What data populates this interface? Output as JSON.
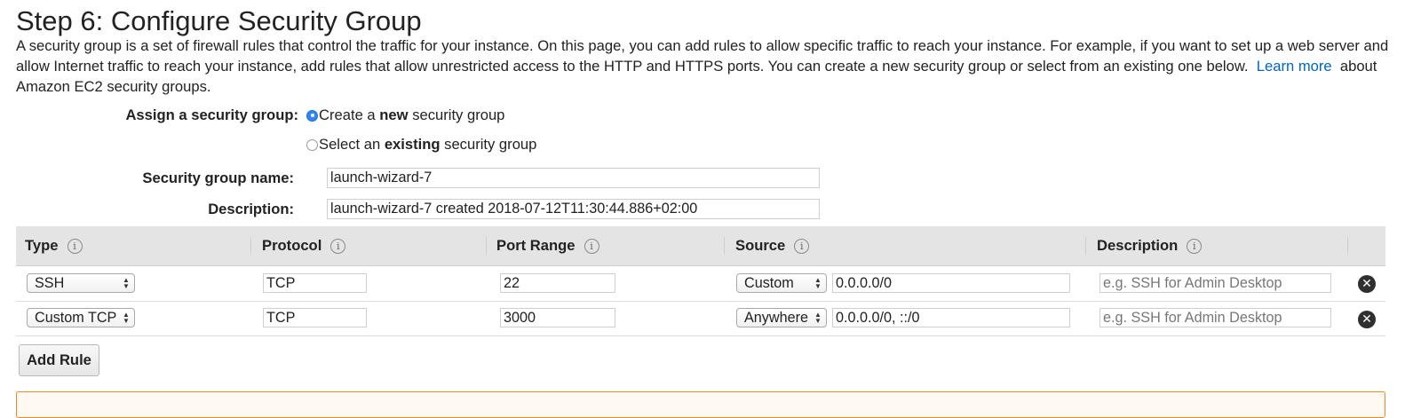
{
  "page": {
    "title": "Step 6: Configure Security Group",
    "intro_text": "A security group is a set of firewall rules that control the traffic for your instance. On this page, you can add rules to allow specific traffic to reach your instance. For example, if you want to set up a web server and allow Internet traffic to reach your instance, add rules that allow unrestricted access to the HTTP and HTTPS ports. You can create a new security group or select from an existing one below.",
    "learn_more_link": "Learn more",
    "intro_tail": "about Amazon EC2 security groups."
  },
  "assign": {
    "label": "Assign a security group:",
    "options": [
      {
        "pre": "Create a",
        "bold": "new",
        "post": "security group",
        "selected": true
      },
      {
        "pre": "Select an",
        "bold": "existing",
        "post": "security group",
        "selected": false
      }
    ]
  },
  "form": {
    "name_label": "Security group name:",
    "name_value": "launch-wizard-7",
    "description_label": "Description:",
    "description_value": "launch-wizard-7 created 2018-07-12T11:30:44.886+02:00"
  },
  "rules_table": {
    "columns": [
      "Type",
      "Protocol",
      "Port Range",
      "Source",
      "Description"
    ],
    "rows": [
      {
        "type": "SSH",
        "protocol": "TCP",
        "port_range": "22",
        "source_mode": "Custom",
        "source_cidr": "0.0.0.0/0",
        "description_placeholder": "e.g. SSH for Admin Desktop"
      },
      {
        "type": "Custom TCP I",
        "protocol": "TCP",
        "port_range": "3000",
        "source_mode": "Anywhere",
        "source_cidr": "0.0.0.0/0, ::/0",
        "description_placeholder": "e.g. SSH for Admin Desktop"
      }
    ],
    "info_icon_glyph": "i",
    "remove_icon_glyph": "✕",
    "add_rule_label": "Add Rule"
  },
  "colors": {
    "link": "#0066c0",
    "radio_selected": "#2f87f2",
    "header_bg": "#e4e4e4",
    "warning_border": "#ec8a2a"
  },
  "icons": [
    "info-icon",
    "remove-rule-icon",
    "select-updown-icon"
  ]
}
